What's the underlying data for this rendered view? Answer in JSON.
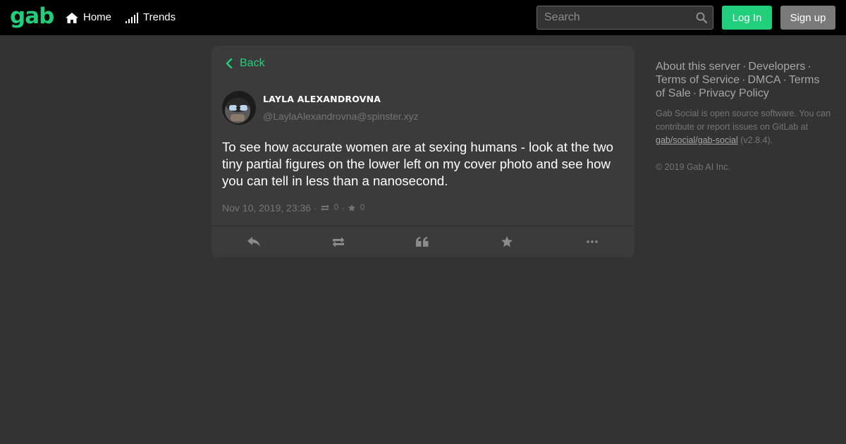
{
  "brand": {
    "logo": "gab",
    "accent": "#21cf7a"
  },
  "nav": {
    "home": "Home",
    "trends": "Trends"
  },
  "search": {
    "placeholder": "Search",
    "value": ""
  },
  "auth": {
    "login": "Log In",
    "signup": "Sign up"
  },
  "status": {
    "back_label": "Back",
    "display_name": "LAYLA ALEXANDROVNA",
    "acct": "@LaylaAlexandrovna@spinster.xyz",
    "content": "To see how accurate women are at sexing humans - look at the two tiny partial figures on the lower left on my cover photo and see how you can tell in less than a nanosecond.",
    "timestamp": "Nov 10, 2019, 23:36",
    "reposts": "0",
    "favourites": "0",
    "actions": [
      "reply-icon",
      "repost-icon",
      "quote-icon",
      "star-icon",
      "ellipsis-icon"
    ]
  },
  "sidebar": {
    "links": [
      "About this server",
      "Developers",
      "Terms of Service",
      "DMCA",
      "Terms of Sale",
      "Privacy Policy"
    ],
    "about_prefix": "Gab Social is open source software. You can contribute or report issues on GitLab at",
    "about_link": "gab/social/gab-social",
    "about_version": "(v2.8.4).",
    "copyright": "© 2019 Gab AI Inc."
  }
}
